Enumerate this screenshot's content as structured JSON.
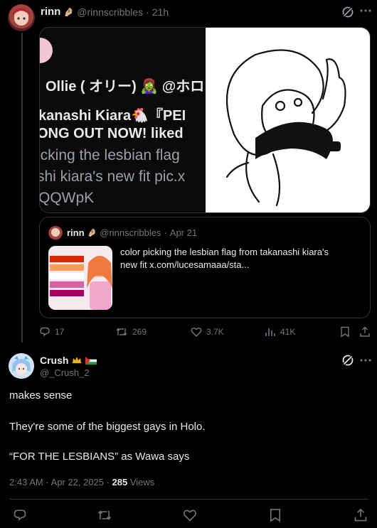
{
  "reply_parent": {
    "name": "rinn",
    "name_emoji": "🤌🏼",
    "handle": "@rinnscribbles",
    "time": "21h",
    "screenshot_text": {
      "line1": "Ollie ( オリー) 🧟‍♀️ @ホロ",
      "line2": "kanashi Kiara🐔『PEI",
      "line3": "ONG OUT NOW! liked",
      "line4": "icking the lesbian flag",
      "line5": "shi kiara's new fit pic.x",
      "line6": "QQWpK"
    },
    "quote": {
      "name": "rinn",
      "name_emoji": "🤌🏼",
      "handle": "@rinnscribbles",
      "time": "Apr 21",
      "text_line1": "color picking the lesbian flag from takanashi kiara's",
      "text_line2": "new fit  x.com/lucesamaaa/sta..."
    },
    "actions": {
      "replies": "17",
      "reposts": "269",
      "likes": "3.7K",
      "views": "41K"
    }
  },
  "main_post": {
    "name": "Crush",
    "handle": "@_Crush_2",
    "line1": "makes sense",
    "line2": "They're some of the  biggest gays in Holo.",
    "line3": "“FOR THE LESBIANS” as Wawa says",
    "time": "2:43 AM · Apr 22, 2025 · ",
    "views_count": "285",
    "views_label": " Views"
  },
  "colors": {
    "background": "#000000",
    "muted": "#71767b",
    "border": "#2f3336",
    "text": "#e7e9ea",
    "lesbian_flag": [
      "#d62900",
      "#ff9b55",
      "#ffffff",
      "#d462a5",
      "#a50062"
    ]
  },
  "icons": [
    "grok-icon",
    "reply-icon",
    "repost-icon",
    "like-icon",
    "views-icon",
    "bookmark-icon",
    "share-icon"
  ]
}
